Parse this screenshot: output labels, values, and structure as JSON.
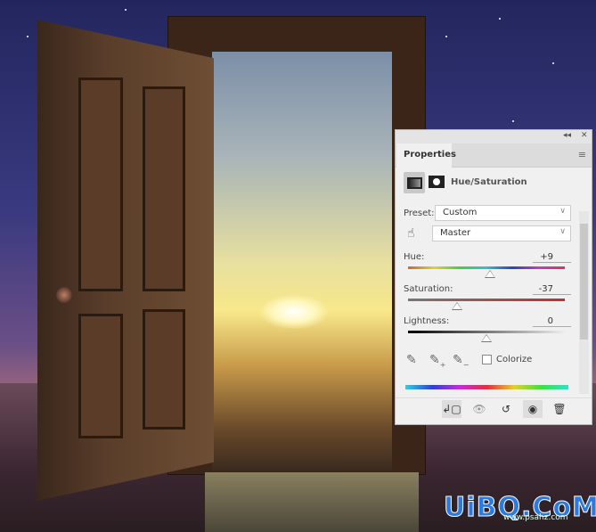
{
  "panel": {
    "tab_label": "Properties",
    "adjustment_title": "Hue/Saturation",
    "preset_label": "Preset:",
    "preset_value": "Custom",
    "channel_value": "Master",
    "hue": {
      "label": "Hue:",
      "value": "+9",
      "numeric": 9,
      "range": [
        -180,
        180
      ]
    },
    "saturation": {
      "label": "Saturation:",
      "value": "-37",
      "numeric": -37,
      "range": [
        -100,
        100
      ]
    },
    "lightness": {
      "label": "Lightness:",
      "value": "0",
      "numeric": 0,
      "range": [
        -100,
        100
      ]
    },
    "colorize_label": "Colorize",
    "colorize_checked": false
  },
  "watermark": {
    "main": "UiBQ.CoM",
    "sub": "www.psahz.com"
  }
}
